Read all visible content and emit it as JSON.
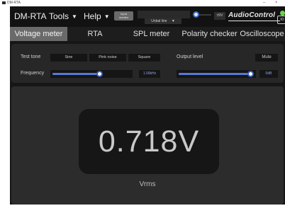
{
  "window": {
    "title": "DM-RTA",
    "minimize": "–",
    "close": "×"
  },
  "header": {
    "brand": "DM-RTA",
    "menus": [
      {
        "label": "Tools",
        "caret": "▼"
      },
      {
        "label": "Help",
        "caret": "▼"
      }
    ],
    "input_button": {
      "line1": "Input",
      "line2": "monitor"
    },
    "input_select": {
      "value": "Unbal line",
      "caret": "▼"
    },
    "level_badge": "±9V",
    "logo": "AudioControl",
    "power_label": "IO",
    "colors": {
      "accent": "#3b6cc8",
      "power_led": "#6cd24a"
    }
  },
  "tabs": [
    {
      "label": "Voltage meter",
      "active": true
    },
    {
      "label": "RTA",
      "active": false
    },
    {
      "label": "SPL meter",
      "active": false
    },
    {
      "label": "Polarity checker",
      "active": false
    },
    {
      "label": "Oscilloscope",
      "active": false
    }
  ],
  "settings": {
    "test_tone_label": "Test tone",
    "tone_options": [
      "Sine",
      "Pink noise",
      "Square"
    ],
    "output_level_label": "Output level",
    "mute_label": "Mute",
    "frequency_label": "Frequency",
    "frequency_value": "1.00kHz",
    "frequency_fraction": 0.61,
    "output_value": "0dB",
    "output_fraction": 0.98
  },
  "meter": {
    "value": "0.718V",
    "unit": "Vrms"
  }
}
